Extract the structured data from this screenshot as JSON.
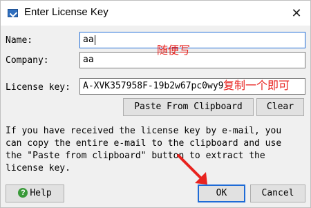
{
  "window": {
    "title": "Enter License Key",
    "icon": "license-app-icon",
    "close_glyph": "✕"
  },
  "form": {
    "name_label": "Name:",
    "name_value": "aa",
    "company_label": "Company:",
    "company_value": "aa",
    "license_label": "License key:",
    "license_value": "A-XVK357958F-19b2w67pc0wy9"
  },
  "buttons": {
    "paste": "Paste From Clipboard",
    "clear": "Clear",
    "help": "Help",
    "help_icon": "?",
    "ok": "OK",
    "cancel": "Cancel"
  },
  "info_lines": [
    "If you have received the license key by e-mail, you",
    "can copy the entire e-mail to the clipboard and use",
    "the \"Paste from clipboard\" button to extract the",
    "license key."
  ],
  "annotations": {
    "name_note": "随便写",
    "key_note": "复制一个即可",
    "color": "#e8231f"
  }
}
